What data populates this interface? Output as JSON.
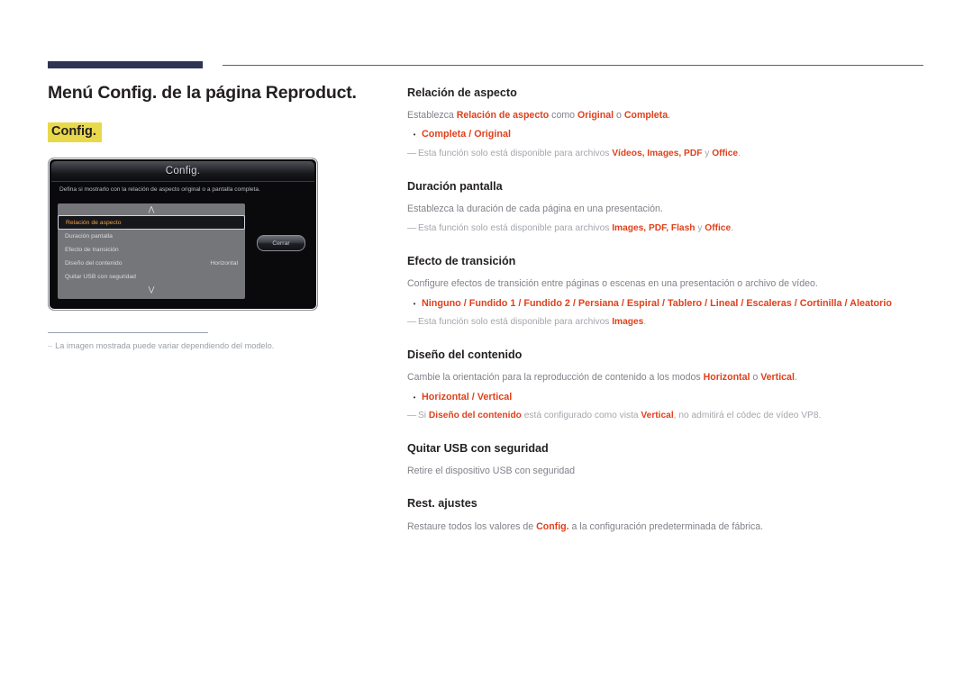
{
  "page": {
    "title": "Menú Config. de la página Reproduct.",
    "config_tag": "Config."
  },
  "device": {
    "title": "Config.",
    "description": "Defina si mostrarlo con la relación de aspecto original o a pantalla completa.",
    "scroll_up_icon": "chevron-up-icon",
    "scroll_down_icon": "chevron-down-icon",
    "up_glyph": "⋀",
    "down_glyph": "⋁",
    "close_label": "Cerrar",
    "menu_items": [
      {
        "label": "Relación de aspecto",
        "value": "",
        "selected": true
      },
      {
        "label": "Duración pantalla",
        "value": "",
        "selected": false
      },
      {
        "label": "Efecto de transición",
        "value": "",
        "selected": false
      },
      {
        "label": "Diseño del contenido",
        "value": "Horizontal",
        "selected": false
      },
      {
        "label": "Quitar USB con seguridad",
        "value": "",
        "selected": false
      }
    ]
  },
  "caption": {
    "dash": "‒",
    "text": "La imagen mostrada puede variar dependiendo del modelo."
  },
  "sections": [
    {
      "id": "relacion-de-aspecto",
      "title": "Relación de aspecto",
      "desc_pre": "Establezca ",
      "desc_red1": "Relación de aspecto",
      "desc_mid1": " como ",
      "desc_red2": "Original",
      "desc_mid2": " o ",
      "desc_red3": "Completa",
      "desc_post": ".",
      "bullet": "Completa / Original",
      "note_pre": "Esta función solo está disponible para archivos ",
      "note_red": "Vídeos, Images, PDF",
      "note_mid": " y ",
      "note_red2": "Office",
      "note_post": "."
    },
    {
      "id": "duracion-pantalla",
      "title": "Duración pantalla",
      "desc": "Establezca la duración de cada página en una presentación.",
      "note_pre": "Esta función solo está disponible para archivos ",
      "note_red": "Images, PDF, Flash",
      "note_mid": " y ",
      "note_red2": "Office",
      "note_post": "."
    },
    {
      "id": "efecto-de-transicion",
      "title": "Efecto de transición",
      "desc": "Configure efectos de transición entre páginas o escenas en una presentación o archivo de vídeo.",
      "bullet": "Ninguno / Fundido 1 / Fundido 2 / Persiana / Espiral / Tablero / Lineal / Escaleras / Cortinilla / Aleatorio",
      "note_pre": "Esta función solo está disponible para archivos ",
      "note_red": "Images",
      "note_post": "."
    },
    {
      "id": "diseno-del-contenido",
      "title": "Diseño del contenido",
      "desc_pre": "Cambie la orientación para la reproducción de contenido a los modos ",
      "desc_red1": "Horizontal",
      "desc_mid1": " o ",
      "desc_red2": "Vertical",
      "desc_post": ".",
      "bullet": "Horizontal / Vertical",
      "note_pre": "Si ",
      "note_red": "Diseño del contenido",
      "note_mid": " está configurado como vista ",
      "note_red2": "Vertical",
      "note_post": ", no admitirá el códec de vídeo VP8."
    },
    {
      "id": "quitar-usb-con-seguridad",
      "title": "Quitar USB con seguridad",
      "desc": "Retire el dispositivo USB con seguridad"
    },
    {
      "id": "rest-ajustes",
      "title": "Rest. ajustes",
      "desc_pre": "Restaure todos los valores de ",
      "desc_red1": "Config.",
      "desc_post": " a la configuración predeterminada de fábrica."
    }
  ],
  "colors": {
    "accent_red": "#e0411c",
    "highlight_yellow": "#e8d94b",
    "rule_navy": "#2e3553",
    "body_gray": "#808289"
  }
}
